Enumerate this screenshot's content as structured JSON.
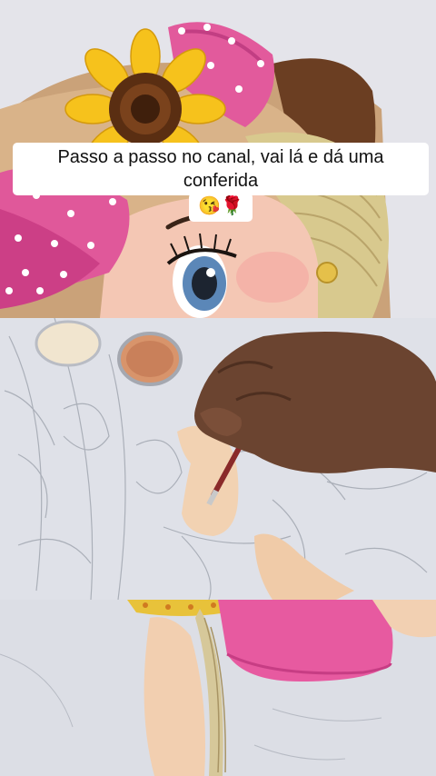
{
  "caption": {
    "line1": "Passo a passo no canal, vai lá e dá uma conferida",
    "line2": "😘🌹"
  },
  "panels": [
    {
      "subject": "painted-doll-with-sunflower-hat"
    },
    {
      "subject": "hand-painting-doll-face"
    },
    {
      "subject": "painted-doll-pink-hat-detail"
    }
  ]
}
